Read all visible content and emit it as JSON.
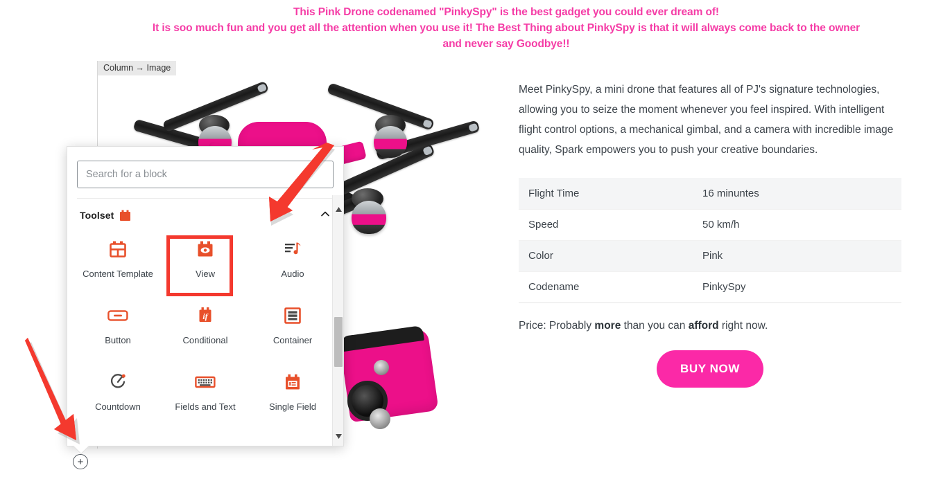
{
  "promo": {
    "line1": "This Pink Drone codenamed \"PinkySpy\" is the best gadget you could ever dream of!",
    "line2": "It is soo much fun and you get all the attention when you use it! The Best Thing about PinkySpy is that it will always come back to the owner",
    "line3": "and never say Goodbye!!",
    "color": "#F53CA6"
  },
  "canvas": {
    "breadcrumb": "Column → Image",
    "image_alt": "pink-drone-photo"
  },
  "inserter": {
    "search": {
      "placeholder": "Search for a block",
      "value": ""
    },
    "section": {
      "title": "Toolset",
      "brand_icon": "toolset-brand-icon",
      "collapse_icon": "chevron-up-icon"
    },
    "blocks": [
      {
        "label": "Content Template",
        "icon": "content-template-icon",
        "selected": false
      },
      {
        "label": "View",
        "icon": "view-eye-icon",
        "selected": true
      },
      {
        "label": "Audio",
        "icon": "audio-note-icon",
        "selected": false
      },
      {
        "label": "Button",
        "icon": "button-icon",
        "selected": false
      },
      {
        "label": "Conditional",
        "icon": "conditional-if-icon",
        "selected": false
      },
      {
        "label": "Container",
        "icon": "container-icon",
        "selected": false
      },
      {
        "label": "Countdown",
        "icon": "countdown-timer-icon",
        "selected": false
      },
      {
        "label": "Fields and Text",
        "icon": "fields-and-text-keyboard-icon",
        "selected": false
      },
      {
        "label": "Single Field",
        "icon": "single-field-icon",
        "selected": false
      }
    ],
    "scrollbar": {
      "up_icon": "triangle-up-icon",
      "down_icon": "triangle-down-icon"
    },
    "add_block_button": "+",
    "highlight_color": "#F4392E",
    "accent_color": "#E8502B"
  },
  "product": {
    "description": "Meet PinkySpy, a mini drone that features all of PJ's signature technologies, allowing you to seize the moment whenever you feel inspired. With intelligent flight control options, a mechanical gimbal, and a camera with incredible image quality, Spark empowers you to push your creative boundaries.",
    "specs": [
      {
        "key": "Flight Time",
        "value": "16 minuntes"
      },
      {
        "key": "Speed",
        "value": "50 km/h"
      },
      {
        "key": "Color",
        "value": "Pink"
      },
      {
        "key": "Codename",
        "value": "PinkySpy"
      }
    ],
    "price": {
      "prefix": "Price: Probably ",
      "bold1": "more",
      "middle": " than you can ",
      "bold2": "afford",
      "suffix": " right now."
    },
    "buy_label": "BUY NOW",
    "buy_color": "#FB29A7"
  },
  "annotations": {
    "arrow_color": "#F4392E",
    "arrow_top_target": "view-block",
    "arrow_bottom_target": "add-block-button"
  }
}
